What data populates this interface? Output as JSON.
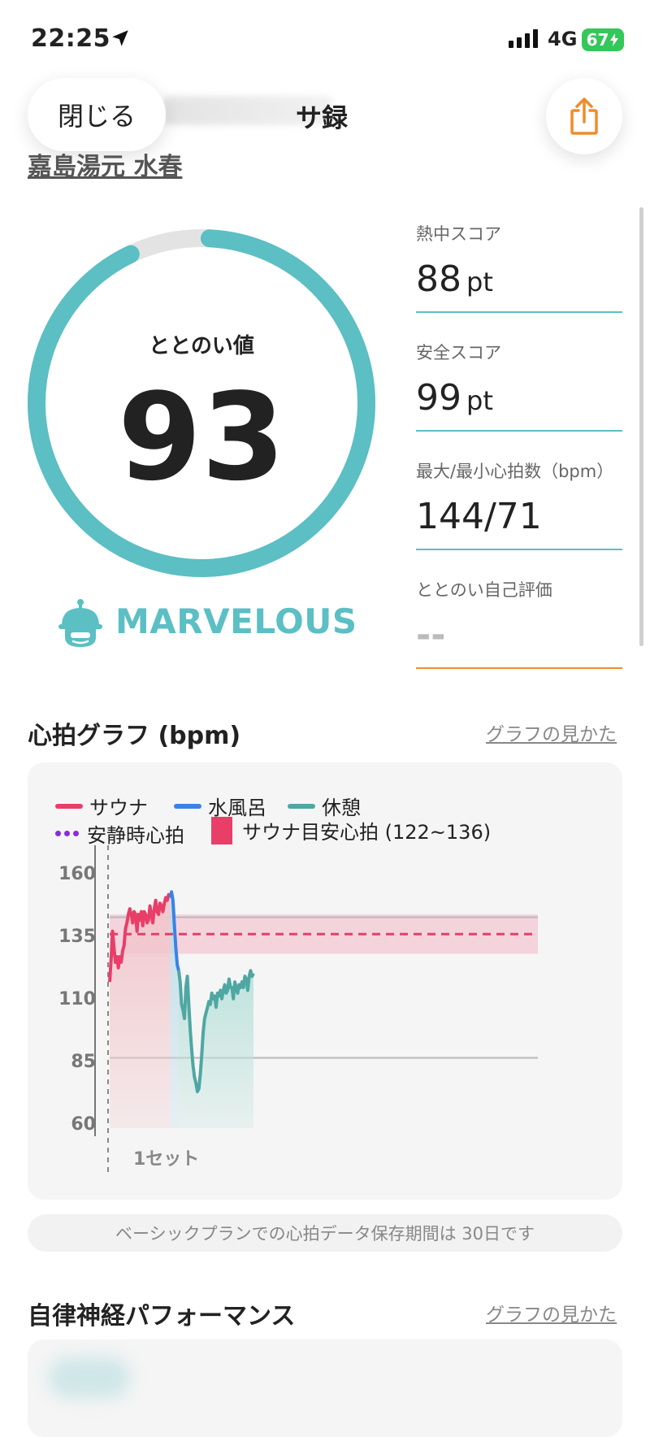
{
  "status_bar": {
    "time": "22:25",
    "network": "4G",
    "battery": "67"
  },
  "header": {
    "close_label": "閉じる",
    "title": "サ録",
    "facility": "嘉島湯元 水春"
  },
  "score": {
    "label": "ととのい値",
    "value": "93",
    "progress_percent": 94,
    "rank": "MARVELOUS",
    "color": "#5bbfc4"
  },
  "stats": [
    {
      "label": "熱中スコア",
      "value": "88",
      "unit": "pt"
    },
    {
      "label": "安全スコア",
      "value": "99",
      "unit": "pt"
    },
    {
      "label": "最大/最小心拍数（bpm）",
      "value": "144/71",
      "unit": ""
    },
    {
      "label": "ととのい自己評価",
      "value": "--",
      "unit": ""
    }
  ],
  "heart_graph": {
    "title": "心拍グラフ (bpm)",
    "help_link": "グラフの見かた",
    "legend": {
      "sauna": "サウナ",
      "water": "水風呂",
      "rest": "休憩",
      "resting": "安静時心拍",
      "target": "サウナ目安心拍 (122~136)"
    },
    "set_label": "1セット",
    "notice": "ベーシックプランでの心拍データ保存期間は 30日です",
    "colors": {
      "sauna": "#e83e68",
      "water": "#3b82e6",
      "rest": "#4fa7a3",
      "resting": "#8a2be2",
      "target": "#e83e68"
    }
  },
  "chart_data": {
    "type": "line",
    "yticks": [
      "160",
      "135",
      "110",
      "85",
      "60"
    ],
    "ylim": [
      60,
      160
    ],
    "target_range": [
      122,
      136
    ],
    "resting_hr": 129,
    "reference_lines": [
      135,
      85
    ],
    "series": [
      {
        "name": "サウナ",
        "x": [
          0,
          1,
          2,
          3,
          4,
          5,
          6,
          7,
          8,
          9,
          10,
          11,
          12,
          13,
          14,
          15,
          16,
          17,
          18,
          19,
          20,
          21,
          22,
          23,
          24,
          25,
          26,
          27,
          28,
          29,
          30,
          31,
          32,
          33,
          34,
          35,
          36,
          37,
          38,
          39,
          40,
          41,
          42
        ],
        "values": [
          112,
          120,
          130,
          124,
          119,
          121,
          117,
          121,
          119,
          123,
          125,
          131,
          133,
          136,
          138,
          136,
          133,
          137,
          136,
          130,
          136,
          134,
          137,
          132,
          137,
          136,
          133,
          134,
          139,
          136,
          133,
          138,
          141,
          137,
          136,
          140,
          139,
          137,
          140,
          142,
          141,
          143,
          142
        ]
      },
      {
        "name": "水風呂",
        "x": [
          42,
          43,
          44,
          45,
          46,
          47,
          48
        ],
        "values": [
          142,
          144,
          141,
          132,
          124,
          118,
          116
        ]
      },
      {
        "name": "休憩",
        "x": [
          48,
          49,
          50,
          51,
          52,
          53,
          54,
          55,
          56,
          57,
          58,
          59,
          60,
          61,
          62,
          63,
          64,
          65,
          66,
          67,
          68,
          69,
          70,
          71,
          72,
          73,
          74,
          75,
          76,
          77,
          78,
          79,
          80,
          81,
          82,
          83,
          84,
          85,
          86,
          87,
          88,
          89,
          90,
          91,
          92,
          93,
          94,
          95,
          96,
          97,
          98,
          99,
          100
        ],
        "values": [
          116,
          112,
          104,
          102,
          99,
          110,
          114,
          104,
          95,
          88,
          82,
          78,
          76,
          73,
          74,
          79,
          86,
          94,
          99,
          101,
          103,
          105,
          104,
          108,
          106,
          107,
          103,
          108,
          107,
          109,
          106,
          109,
          111,
          108,
          109,
          113,
          110,
          110,
          106,
          112,
          110,
          108,
          111,
          110,
          112,
          110,
          114,
          113,
          109,
          114,
          116,
          114,
          115
        ]
      }
    ]
  },
  "autonomic": {
    "title": "自律神経パフォーマンス",
    "help_link": "グラフの見かた"
  }
}
